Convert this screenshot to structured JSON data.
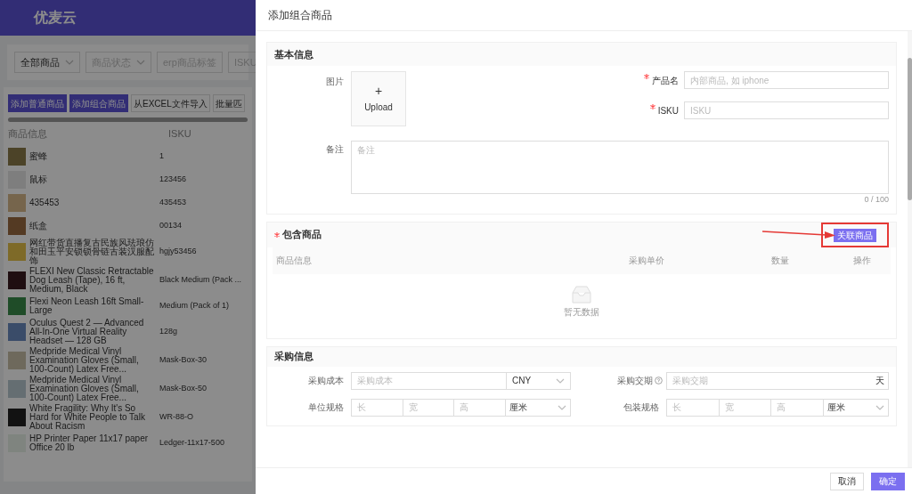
{
  "app": {
    "logo": "优麦云"
  },
  "filters": [
    {
      "label": "全部商品",
      "kind": "select"
    },
    {
      "label": "商品状态",
      "kind": "select"
    },
    {
      "label": "erp商品标签",
      "kind": "input"
    },
    {
      "label": "ISKU",
      "kind": "input"
    }
  ],
  "actions": [
    {
      "label": "添加普通商品",
      "primary": true
    },
    {
      "label": "添加组合商品",
      "primary": true
    },
    {
      "label": "从EXCEL文件导入",
      "primary": false
    },
    {
      "label": "批量匹",
      "primary": false
    }
  ],
  "product_table": {
    "columns": [
      "商品信息",
      "ISKU"
    ],
    "rows": [
      {
        "name": "蜜蜂",
        "isku": "1"
      },
      {
        "name": "鼠标",
        "isku": "123456"
      },
      {
        "name": "435453",
        "isku": "435453"
      },
      {
        "name": "纸盒",
        "isku": "00134"
      },
      {
        "name": "网红带货直播复古民族风珐琅仿和田玉平安锁锁骨链古装汉服配饰",
        "isku": "hgjy53456"
      },
      {
        "name": "FLEXI New Classic Retractable Dog Leash (Tape), 16 ft, Medium, Black",
        "isku": "Black Medium (Pack ..."
      },
      {
        "name": "Flexi Neon Leash 16ft Small-Large",
        "isku": "Medium (Pack of 1)"
      },
      {
        "name": "Oculus Quest 2 — Advanced All-In-One Virtual Reality Headset — 128 GB",
        "isku": "128g"
      },
      {
        "name": "Medpride Medical Vinyl Examination Gloves (Small, 100-Count) Latex Free...",
        "isku": "Mask-Box-30"
      },
      {
        "name": "Medpride Medical Vinyl Examination Gloves (Small, 100-Count) Latex Free...",
        "isku": "Mask-Box-50"
      },
      {
        "name": "White Fragility: Why It's So Hard for White People to Talk About Racism",
        "isku": "WR-88-O"
      },
      {
        "name": "HP Printer Paper 11x17 paper Office 20 lb",
        "isku": "Ledger-11x17-500"
      }
    ]
  },
  "drawer": {
    "title": "添加组合商品",
    "basic": {
      "title": "基本信息",
      "image_label": "图片",
      "upload_plus": "+",
      "upload": "Upload",
      "fields": [
        {
          "label": "产品名",
          "required": true,
          "placeholder": "内部商品, 如 iphone"
        },
        {
          "label": "ISKU",
          "required": true,
          "placeholder": "ISKU"
        }
      ],
      "remark": {
        "label": "备注",
        "placeholder": "备注",
        "counter": "0 / 100"
      }
    },
    "included": {
      "title": "包含商品",
      "required": true,
      "button": "关联商品",
      "columns": [
        "商品信息",
        "采购单价",
        "数量",
        "操作"
      ],
      "empty": "暂无数据"
    },
    "purchase": {
      "title": "采购信息",
      "cost": {
        "label": "采购成本",
        "placeholder": "采购成本",
        "currency": "CNY"
      },
      "lead": {
        "label": "采购交期",
        "placeholder": "采购交期",
        "suffix": "天"
      },
      "specs": [
        {
          "label": "单位规格",
          "placeholders": [
            "长",
            "宽",
            "高"
          ],
          "unit": "厘米"
        },
        {
          "label": "包装规格",
          "placeholders": [
            "长",
            "宽",
            "高"
          ],
          "unit": "厘米"
        }
      ]
    },
    "footer": [
      {
        "label": "取消",
        "primary": false
      },
      {
        "label": "确定",
        "primary": true
      }
    ]
  }
}
